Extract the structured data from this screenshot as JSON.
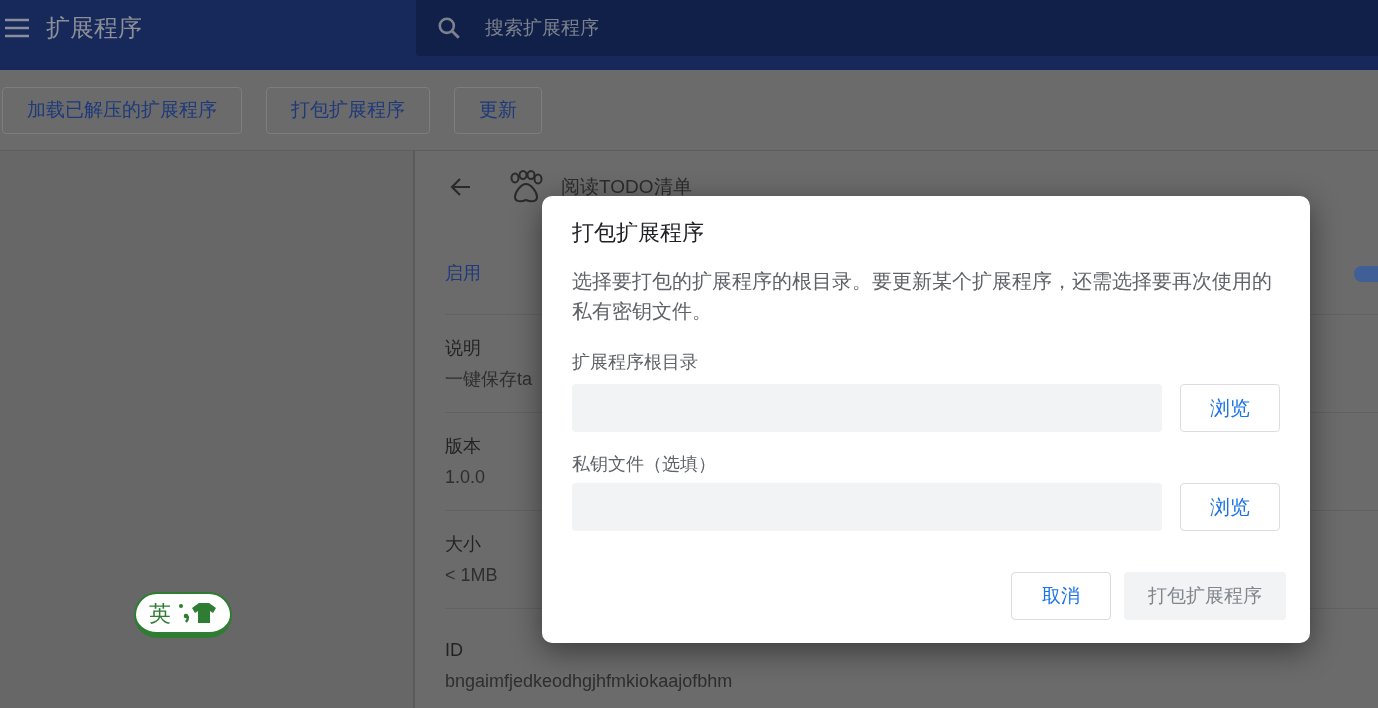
{
  "header": {
    "title": "扩展程序",
    "search": {
      "placeholder": "搜索扩展程序"
    }
  },
  "toolbar": {
    "buttons": [
      "加载已解压的扩展程序",
      "打包扩展程序",
      "更新"
    ]
  },
  "details": {
    "name": "阅读TODO清单",
    "enabled": {
      "label": "启用",
      "on": true
    },
    "rows": [
      {
        "label": "说明",
        "value": "一键保存ta"
      },
      {
        "label": "版本",
        "value": "1.0.0"
      },
      {
        "label": "大小",
        "value": "< 1MB"
      },
      {
        "label": "ID",
        "value": "bngaimfjedkeodhgjhfmkiokaajofbhm"
      }
    ]
  },
  "ime": {
    "label": "英"
  },
  "dialog": {
    "title": "打包扩展程序",
    "description": "选择要打包的扩展程序的根目录。要更新某个扩展程序，还需选择要再次使用的私有密钥文件。",
    "fields": [
      {
        "label": "扩展程序根目录",
        "button": "浏览"
      },
      {
        "label": "私钥文件（选填）",
        "button": "浏览"
      }
    ],
    "buttons": [
      {
        "label": "取消",
        "disabled": false
      },
      {
        "label": "打包扩展程序",
        "disabled": true
      }
    ]
  }
}
